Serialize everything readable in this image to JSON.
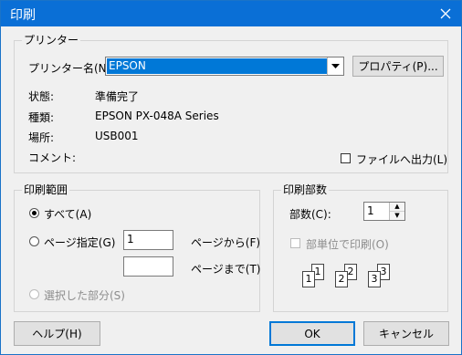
{
  "window": {
    "title": "印刷"
  },
  "printer": {
    "group_label": "プリンター",
    "name_label": "プリンター名(N):",
    "selected_printer": "EPSON",
    "properties_button": "プロパティ(P)...",
    "status_label": "状態:",
    "status_value": "準備完了",
    "type_label": "種類:",
    "type_value": "EPSON PX-048A Series",
    "location_label": "場所:",
    "location_value": "USB001",
    "comment_label": "コメント:",
    "print_to_file_label": "ファイルへ出力(L)"
  },
  "range": {
    "group_label": "印刷範囲",
    "all_label": "すべて(A)",
    "pages_label": "ページ指定(G)",
    "from_value": "1",
    "from_label": "ページから(F)",
    "to_value": "",
    "to_label": "ページまで(T)",
    "selection_label": "選択した部分(S)"
  },
  "copies": {
    "group_label": "印刷部数",
    "count_label": "部数(C):",
    "count_value": "1",
    "collate_label": "部単位で印刷(O)",
    "collate_pages": [
      "1",
      "1",
      "2",
      "2",
      "3",
      "3"
    ]
  },
  "buttons": {
    "help": "ヘルプ(H)",
    "ok": "OK",
    "cancel": "キャンセル"
  }
}
